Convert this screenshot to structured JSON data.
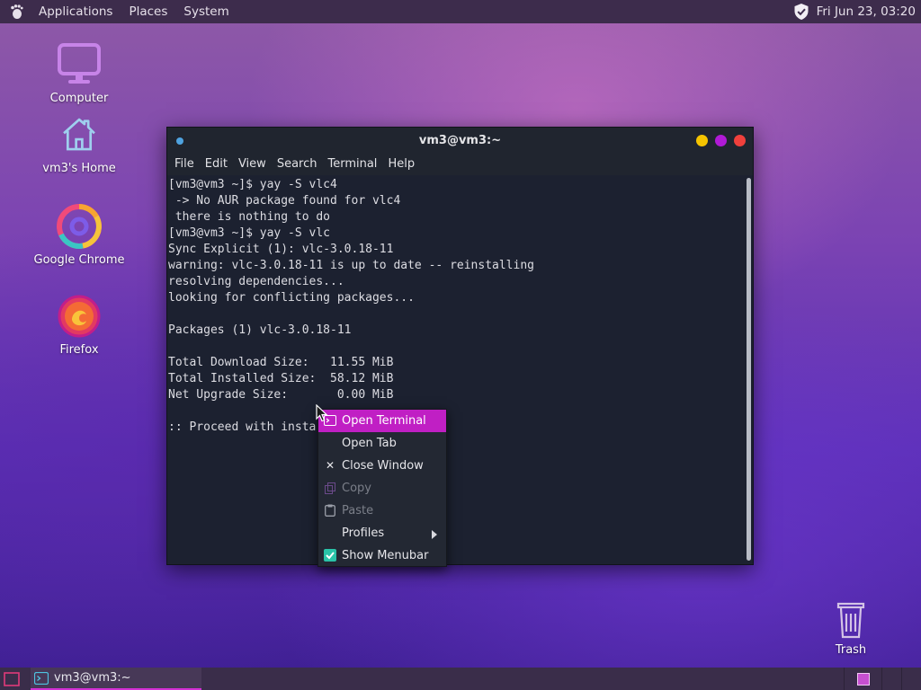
{
  "top_panel": {
    "menus": [
      "Applications",
      "Places",
      "System"
    ],
    "clock": "Fri Jun 23, 03:20"
  },
  "desktop_icons": [
    {
      "label": "Computer",
      "icon": "monitor-icon"
    },
    {
      "label": "vm3's Home",
      "icon": "home-folder-icon"
    },
    {
      "label": "Google Chrome",
      "icon": "chrome-icon"
    },
    {
      "label": "Firefox",
      "icon": "firefox-icon"
    }
  ],
  "trash": {
    "label": "Trash",
    "icon": "trash-icon"
  },
  "terminal": {
    "title": "vm3@vm3:~",
    "menus": [
      "File",
      "Edit",
      "View",
      "Search",
      "Terminal",
      "Help"
    ],
    "lines": [
      "[vm3@vm3 ~]$ yay -S vlc4",
      " -> No AUR package found for vlc4",
      " there is nothing to do",
      "[vm3@vm3 ~]$ yay -S vlc",
      "Sync Explicit (1): vlc-3.0.18-11",
      "warning: vlc-3.0.18-11 is up to date -- reinstalling",
      "resolving dependencies...",
      "looking for conflicting packages...",
      "",
      "Packages (1) vlc-3.0.18-11",
      "",
      "Total Download Size:   11.55 MiB",
      "Total Installed Size:  58.12 MiB",
      "Net Upgrade Size:       0.00 MiB",
      "",
      ":: Proceed with insta"
    ]
  },
  "context_menu": {
    "items": [
      {
        "label": "Open Terminal",
        "state": "active",
        "icon": "terminal-icon"
      },
      {
        "label": "Open Tab",
        "state": "normal",
        "icon": ""
      },
      {
        "label": "Close Window",
        "state": "normal",
        "icon": "close-icon"
      },
      {
        "label": "Copy",
        "state": "disabled",
        "icon": "copy-icon"
      },
      {
        "label": "Paste",
        "state": "disabled",
        "icon": "paste-icon"
      },
      {
        "label": "Profiles",
        "state": "submenu",
        "icon": ""
      },
      {
        "label": "Show Menubar",
        "state": "checked",
        "icon": "checkbox-checked-icon"
      }
    ]
  },
  "taskbar": {
    "task_label": "vm3@vm3:~"
  },
  "colors": {
    "accent": "#c01fc4",
    "check": "#2ac3a8",
    "dot_yellow": "#f5c400",
    "dot_purple": "#b01ad6",
    "dot_red": "#f0403c"
  }
}
